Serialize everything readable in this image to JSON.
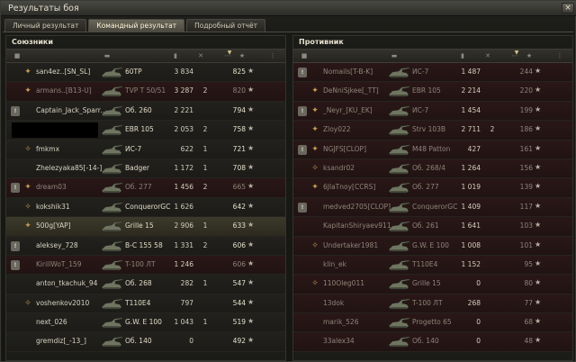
{
  "window": {
    "title": "Результаты боя",
    "close_label": "×"
  },
  "tabs": [
    {
      "label": "Личный результат",
      "active": false
    },
    {
      "label": "Командный результат",
      "active": true
    },
    {
      "label": "Подробный отчёт",
      "active": false
    }
  ],
  "allies": {
    "title": "Союзники",
    "rows": [
      {
        "platoon": "",
        "badge": "✦",
        "name": "san4ez..[SN_SL]",
        "tank": "60TP",
        "damage": "3 834",
        "kills": "",
        "xp": "825",
        "state": "alive"
      },
      {
        "platoon": "",
        "badge": "✦",
        "name": "armans..[B13-U]",
        "tank": "TVP T 50/51",
        "damage": "3 287",
        "kills": "2",
        "xp": "820",
        "state": "dead"
      },
      {
        "platoon": "!",
        "badge": "",
        "name": "Captain_Jack_Sparr...",
        "tank": "Об. 260",
        "damage": "2 221",
        "kills": "",
        "xp": "794",
        "state": "alive"
      },
      {
        "platoon": "",
        "badge": "",
        "name": "",
        "tank": "EBR 105",
        "damage": "2 053",
        "kills": "2",
        "xp": "758",
        "state": "alive",
        "redacted": true
      },
      {
        "platoon": "",
        "badge": "✧",
        "name": "fmkmx",
        "tank": "ИС-7",
        "damage": "622",
        "kills": "1",
        "xp": "721",
        "state": "alive"
      },
      {
        "platoon": "",
        "badge": "",
        "name": "Zhelezyaka85[-14-]",
        "tank": "Badger",
        "damage": "1 172",
        "kills": "1",
        "xp": "708",
        "state": "alive"
      },
      {
        "platoon": "!",
        "badge": "✦",
        "name": "dream03",
        "tank": "Об. 277",
        "damage": "1 456",
        "kills": "2",
        "xp": "665",
        "state": "dead"
      },
      {
        "platoon": "",
        "badge": "✧",
        "name": "kokshik31",
        "tank": "ConquerorGC",
        "damage": "1 626",
        "kills": "",
        "xp": "642",
        "state": "alive"
      },
      {
        "platoon": "",
        "badge": "✦",
        "name": "500g[YAP]",
        "tank": "Grille 15",
        "damage": "2 906",
        "kills": "1",
        "xp": "633",
        "state": "me"
      },
      {
        "platoon": "!",
        "badge": "",
        "name": "aleksey_728",
        "tank": "B-C 155 58",
        "damage": "1 331",
        "kills": "2",
        "xp": "606",
        "state": "alive"
      },
      {
        "platoon": "!",
        "badge": "",
        "name": "KirillWoT_159",
        "tank": "T-100 ЛТ",
        "damage": "1 246",
        "kills": "",
        "xp": "606",
        "state": "dead"
      },
      {
        "platoon": "",
        "badge": "",
        "name": "anton_tkachuk_94",
        "tank": "Об. 268",
        "damage": "282",
        "kills": "1",
        "xp": "547",
        "state": "alive"
      },
      {
        "platoon": "",
        "badge": "✧",
        "name": "voshenkov2010",
        "tank": "T110E4",
        "damage": "797",
        "kills": "",
        "xp": "544",
        "state": "alive"
      },
      {
        "platoon": "",
        "badge": "",
        "name": "next_026",
        "tank": "G.W. E 100",
        "damage": "1 043",
        "kills": "1",
        "xp": "519",
        "state": "alive"
      },
      {
        "platoon": "",
        "badge": "",
        "name": "gremdiz[_-13_]",
        "tank": "Об. 140",
        "damage": "0",
        "kills": "",
        "xp": "492",
        "state": "alive"
      }
    ]
  },
  "enemies": {
    "title": "Противник",
    "rows": [
      {
        "platoon": "!",
        "badge": "",
        "name": "Nomails[T-B-K]",
        "tank": "ИС-7",
        "damage": "1 487",
        "kills": "",
        "xp": "244",
        "state": "dead"
      },
      {
        "platoon": "",
        "badge": "✦",
        "name": "DeNniSjkee[_TT]",
        "tank": "EBR 105",
        "damage": "2 214",
        "kills": "",
        "xp": "220",
        "state": "dead"
      },
      {
        "platoon": "!",
        "badge": "✦",
        "name": "_Neyr_[KU_EK]",
        "tank": "ИС-7",
        "damage": "1 454",
        "kills": "",
        "xp": "199",
        "state": "dead"
      },
      {
        "platoon": "",
        "badge": "✦",
        "name": "Zloy022",
        "tank": "Strv 103B",
        "damage": "2 711",
        "kills": "2",
        "xp": "186",
        "state": "dead"
      },
      {
        "platoon": "!",
        "badge": "✦",
        "name": "NGJFS[CLOP]",
        "tank": "M48 Patton",
        "damage": "427",
        "kills": "",
        "xp": "161",
        "state": "dead"
      },
      {
        "platoon": "",
        "badge": "✧",
        "name": "ksandr02",
        "tank": "Об. 268/4",
        "damage": "1 264",
        "kills": "",
        "xp": "156",
        "state": "dead"
      },
      {
        "platoon": "",
        "badge": "✦",
        "name": "6JlaTnoy[CCRS]",
        "tank": "Об. 277",
        "damage": "1 019",
        "kills": "",
        "xp": "139",
        "state": "dead"
      },
      {
        "platoon": "!",
        "badge": "",
        "name": "medved2705[CLOP]",
        "tank": "ConquerorGC",
        "damage": "1 409",
        "kills": "",
        "xp": "117",
        "state": "dead"
      },
      {
        "platoon": "",
        "badge": "",
        "name": "KapitanShiryaev911",
        "tank": "Об. 261",
        "damage": "1 641",
        "kills": "",
        "xp": "103",
        "state": "dead"
      },
      {
        "platoon": "",
        "badge": "✧",
        "name": "Undertaker1981",
        "tank": "G.W. E 100",
        "damage": "1 008",
        "kills": "",
        "xp": "101",
        "state": "dead"
      },
      {
        "platoon": "",
        "badge": "",
        "name": "klin_ek",
        "tank": "T110E4",
        "damage": "1 152",
        "kills": "",
        "xp": "95",
        "state": "dead"
      },
      {
        "platoon": "",
        "badge": "✧",
        "name": "110Oleg011",
        "tank": "Grille 15",
        "damage": "0",
        "kills": "",
        "xp": "80",
        "state": "dead"
      },
      {
        "platoon": "",
        "badge": "",
        "name": "13dok",
        "tank": "T-100 ЛТ",
        "damage": "268",
        "kills": "",
        "xp": "77",
        "state": "dead"
      },
      {
        "platoon": "",
        "badge": "",
        "name": "marik_526",
        "tank": "Progetto 65",
        "damage": "0",
        "kills": "",
        "xp": "68",
        "state": "dead"
      },
      {
        "platoon": "",
        "badge": "",
        "name": "33alex34",
        "tank": "Об. 140",
        "damage": "0",
        "kills": "",
        "xp": "48",
        "state": "dead"
      }
    ]
  },
  "columns": {
    "platoon_icon": "platoon-icon",
    "tank_icon": "tank-icon",
    "damage_icon": "damage-icon",
    "kills_icon": "kills-icon",
    "xp_icon": "star-icon",
    "star_glyph": "★",
    "sort_glyph": "▼",
    "menu_icon": "more-icon"
  }
}
